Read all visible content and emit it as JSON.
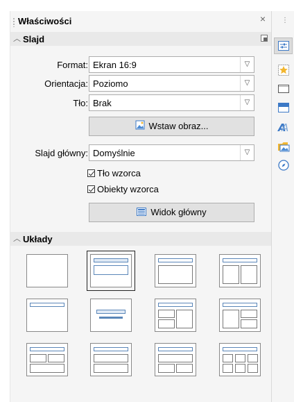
{
  "panel": {
    "title": "Właściwości",
    "close_glyph": "×"
  },
  "slide_section": {
    "title": "Slajd",
    "format_label": "Format:",
    "format_value": "Ekran 16:9",
    "orientation_label": "Orientacja:",
    "orientation_value": "Poziomo",
    "background_label": "Tło:",
    "background_value": "Brak",
    "insert_image_label": "Wstaw obraz...",
    "master_slide_label": "Slajd główny:",
    "master_slide_value": "Domyślnie",
    "master_background_label": "Tło wzorca",
    "master_background_checked": true,
    "master_objects_label": "Obiekty wzorca",
    "master_objects_checked": true,
    "master_view_label": "Widok główny"
  },
  "layouts_section": {
    "title": "Układy",
    "selected_index": 1,
    "count": 12
  },
  "sidebar": {
    "grip": "⋮",
    "icons": [
      "properties-icon",
      "styles-icon",
      "gallery-icon",
      "slide-transition-icon",
      "fontwork-icon",
      "image-icon",
      "navigator-icon"
    ]
  },
  "colors": {
    "accent": "#3c79c6",
    "panel": "#f5f5f5",
    "section": "#e9e9e9"
  }
}
